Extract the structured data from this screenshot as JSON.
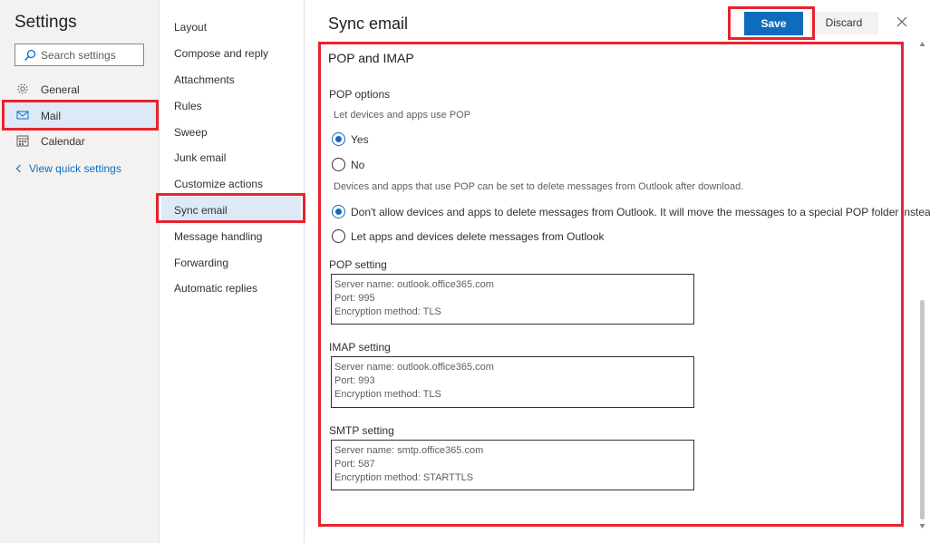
{
  "sidebar": {
    "title": "Settings",
    "search_placeholder": "Search settings",
    "items": [
      {
        "label": "General",
        "icon": "gear-icon"
      },
      {
        "label": "Mail",
        "icon": "mail-icon",
        "selected": true
      },
      {
        "label": "Calendar",
        "icon": "calendar-icon"
      }
    ],
    "quick_settings_label": "View quick settings"
  },
  "mail_nav": {
    "items": [
      {
        "label": "Layout"
      },
      {
        "label": "Compose and reply"
      },
      {
        "label": "Attachments"
      },
      {
        "label": "Rules"
      },
      {
        "label": "Sweep"
      },
      {
        "label": "Junk email"
      },
      {
        "label": "Customize actions"
      },
      {
        "label": "Sync email",
        "selected": true
      },
      {
        "label": "Message handling"
      },
      {
        "label": "Forwarding"
      },
      {
        "label": "Automatic replies"
      }
    ]
  },
  "header": {
    "title": "Sync email",
    "save_label": "Save",
    "discard_label": "Discard"
  },
  "pop_imap": {
    "section_title": "POP and IMAP",
    "pop_options_heading": "POP options",
    "pop_prompt": "Let devices and apps use POP",
    "pop_yes": "Yes",
    "pop_no": "No",
    "pop_enabled": true,
    "delete_prompt": "Devices and apps that use POP can be set to delete messages from Outlook after download.",
    "delete_option_disallow": "Don't allow devices and apps to delete messages from Outlook. It will move the messages to a special POP folder instead.",
    "delete_option_allow": "Let apps and devices delete messages from Outlook",
    "delete_allowed": false,
    "pop_setting": {
      "heading": "POP setting",
      "server": "Server name: outlook.office365.com",
      "port": "Port: 995",
      "encryption": "Encryption method: TLS"
    },
    "imap_setting": {
      "heading": "IMAP setting",
      "server": "Server name: outlook.office365.com",
      "port": "Port: 993",
      "encryption": "Encryption method: TLS"
    },
    "smtp_setting": {
      "heading": "SMTP setting",
      "server": "Server name: smtp.office365.com",
      "port": "Port: 587",
      "encryption": "Encryption method: STARTTLS"
    }
  },
  "colors": {
    "accent": "#0f6cbd",
    "selection": "#dde9f6",
    "annotation": "#e8232e"
  }
}
